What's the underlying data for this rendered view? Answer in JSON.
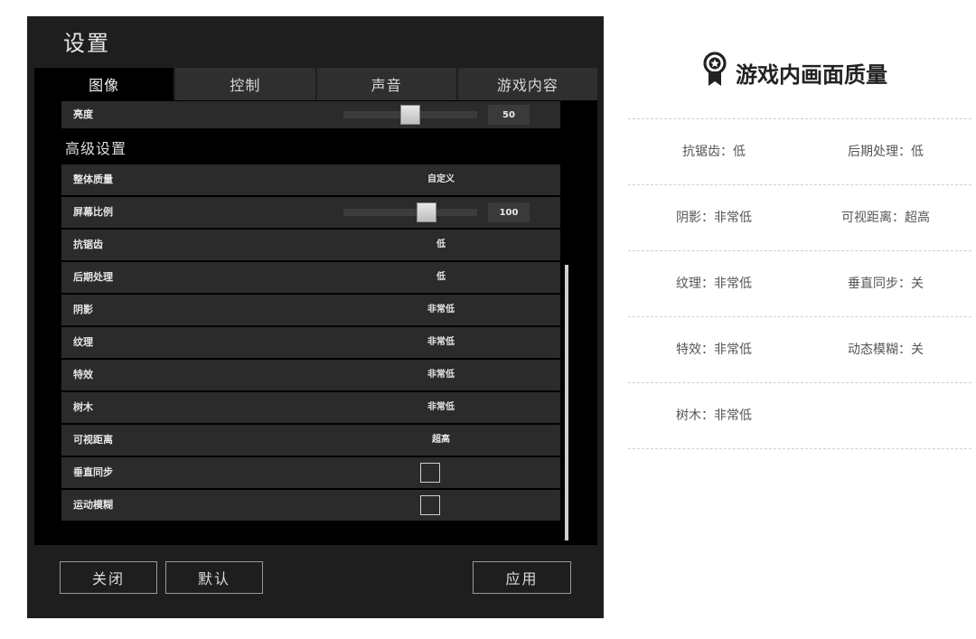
{
  "window": {
    "title": "设置",
    "tabs": [
      "图像",
      "控制",
      "声音",
      "游戏内容"
    ],
    "active_tab": "图像"
  },
  "brightness": {
    "label": "亮度",
    "value": "50",
    "slider_fraction": 0.5
  },
  "advanced": {
    "heading": "高级设置",
    "overall_quality": {
      "label": "整体质量",
      "value": "自定义"
    },
    "screen_scale": {
      "label": "屏幕比例",
      "value": "100",
      "slider_fraction": 0.62
    },
    "rows": [
      {
        "label": "抗锯齿",
        "value": "低"
      },
      {
        "label": "后期处理",
        "value": "低"
      },
      {
        "label": "阴影",
        "value": "非常低"
      },
      {
        "label": "纹理",
        "value": "非常低"
      },
      {
        "label": "特效",
        "value": "非常低"
      },
      {
        "label": "树木",
        "value": "非常低"
      },
      {
        "label": "可视距离",
        "value": "超高"
      }
    ],
    "vsync": {
      "label": "垂直同步",
      "checked": false
    },
    "motion_blur": {
      "label": "运动模糊",
      "checked": false
    }
  },
  "buttons": {
    "close": "关闭",
    "default": "默认",
    "apply": "应用"
  },
  "panel": {
    "title": "游戏内画面质量",
    "icon": "award-badge-icon",
    "items": [
      [
        "抗锯齿：低",
        "后期处理：低"
      ],
      [
        "阴影：非常低",
        "可视距离：超高"
      ],
      [
        "纹理：非常低",
        "垂直同步：关"
      ],
      [
        "特效：非常低",
        "动态模糊：关"
      ],
      [
        "树木：非常低",
        ""
      ]
    ]
  }
}
